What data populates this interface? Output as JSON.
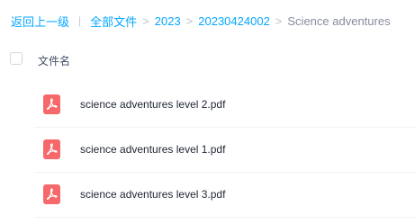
{
  "breadcrumb": {
    "back": "返回上一级",
    "divider": "|",
    "items": [
      {
        "label": "全部文件"
      },
      {
        "label": "2023"
      },
      {
        "label": "20230424002"
      }
    ],
    "separator": ">",
    "current": "Science adventures"
  },
  "list": {
    "column_header": "文件名",
    "files": [
      {
        "name": "science adventures level 2.pdf",
        "icon": "pdf-icon"
      },
      {
        "name": "science adventures level 1.pdf",
        "icon": "pdf-icon"
      },
      {
        "name": "science adventures level 3.pdf",
        "icon": "pdf-icon"
      }
    ]
  },
  "colors": {
    "link": "#06a7ff",
    "pdf_icon": "#f7686b",
    "current_crumb": "#878c9c"
  }
}
